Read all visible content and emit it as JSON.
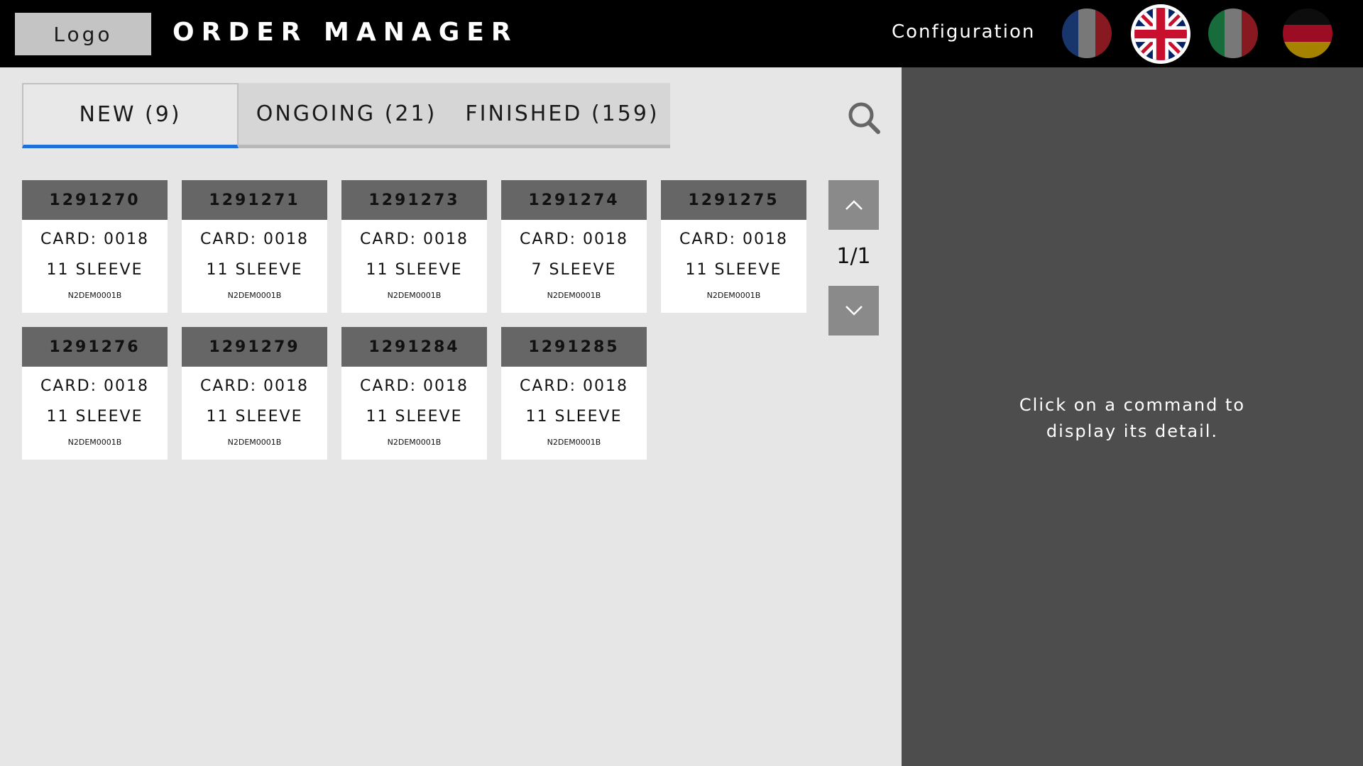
{
  "header": {
    "logo_label": "Logo",
    "title": "ORDER MANAGER",
    "config_label": "Configuration",
    "languages": [
      {
        "code": "fr",
        "icon": "france-flag-icon",
        "selected": false
      },
      {
        "code": "en",
        "icon": "uk-flag-icon",
        "selected": true
      },
      {
        "code": "it",
        "icon": "italy-flag-icon",
        "selected": false
      },
      {
        "code": "de",
        "icon": "germany-flag-icon",
        "selected": false
      }
    ]
  },
  "tabs": [
    {
      "label": "NEW (9)",
      "active": true
    },
    {
      "label": "ONGOING (21)",
      "active": false
    },
    {
      "label": "FINISHED (159)",
      "active": false
    }
  ],
  "search": {
    "icon": "search-icon"
  },
  "orders": [
    {
      "id": "1291270",
      "card": "CARD: 0018",
      "sleeve": "11 SLEEVE",
      "ref": "N2DEM0001B"
    },
    {
      "id": "1291271",
      "card": "CARD: 0018",
      "sleeve": "11 SLEEVE",
      "ref": "N2DEM0001B"
    },
    {
      "id": "1291273",
      "card": "CARD: 0018",
      "sleeve": "11 SLEEVE",
      "ref": "N2DEM0001B"
    },
    {
      "id": "1291274",
      "card": "CARD: 0018",
      "sleeve": "7 SLEEVE",
      "ref": "N2DEM0001B"
    },
    {
      "id": "1291275",
      "card": "CARD: 0018",
      "sleeve": "11 SLEEVE",
      "ref": "N2DEM0001B"
    },
    {
      "id": "1291276",
      "card": "CARD: 0018",
      "sleeve": "11 SLEEVE",
      "ref": "N2DEM0001B"
    },
    {
      "id": "1291279",
      "card": "CARD: 0018",
      "sleeve": "11 SLEEVE",
      "ref": "N2DEM0001B"
    },
    {
      "id": "1291284",
      "card": "CARD: 0018",
      "sleeve": "11 SLEEVE",
      "ref": "N2DEM0001B"
    },
    {
      "id": "1291285",
      "card": "CARD: 0018",
      "sleeve": "11 SLEEVE",
      "ref": "N2DEM0001B"
    }
  ],
  "pagination": {
    "indicator": "1/1",
    "up_icon": "chevron-up-icon",
    "down_icon": "chevron-down-icon"
  },
  "detail": {
    "hint_line1": "Click on a command to",
    "hint_line2": "display its detail."
  },
  "colors": {
    "accent": "#1e6fd9",
    "header_bg": "#000000",
    "detail_bg": "#4d4d4d",
    "card_head": "#666666"
  }
}
